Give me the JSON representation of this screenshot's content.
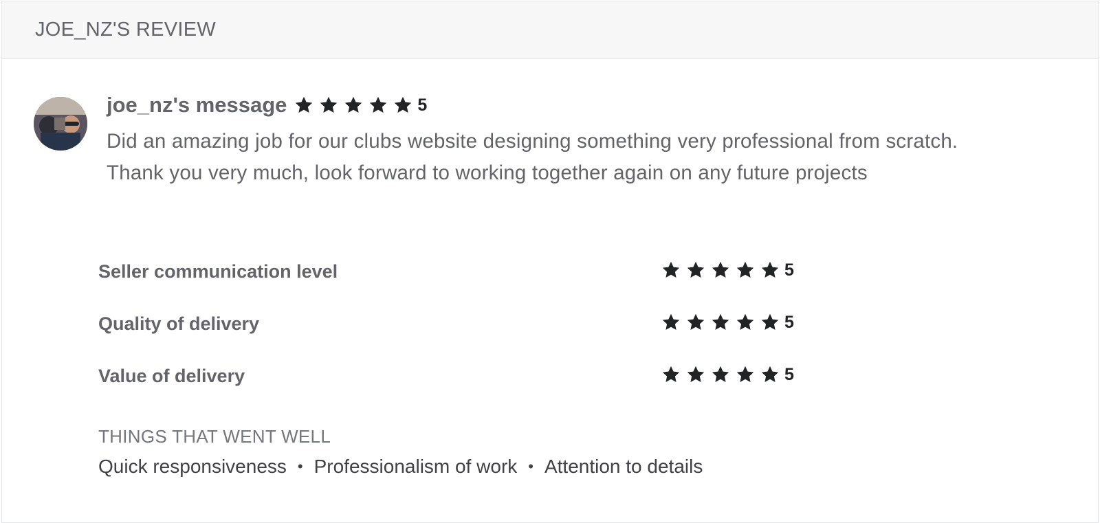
{
  "header": {
    "title": "JOE_NZ'S REVIEW"
  },
  "review": {
    "avatar_icon": "user-avatar-photo",
    "title": "joe_nz's message",
    "rating": 5,
    "rating_text": "5",
    "text": "Did an amazing job for our clubs website designing something very professional from scratch. Thank you very much, look forward to working together again on any future projects"
  },
  "ratings": [
    {
      "label": "Seller communication level",
      "rating": 5,
      "rating_text": "5"
    },
    {
      "label": "Quality of delivery",
      "rating": 5,
      "rating_text": "5"
    },
    {
      "label": "Value of delivery",
      "rating": 5,
      "rating_text": "5"
    }
  ],
  "went_well": {
    "title": "THINGS THAT WENT WELL",
    "tags": [
      "Quick responsiveness",
      "Professionalism of work",
      "Attention to details"
    ],
    "separator": "•"
  },
  "colors": {
    "star": "#222325",
    "text_muted": "#62646a",
    "header_bg": "#f7f7f7"
  }
}
